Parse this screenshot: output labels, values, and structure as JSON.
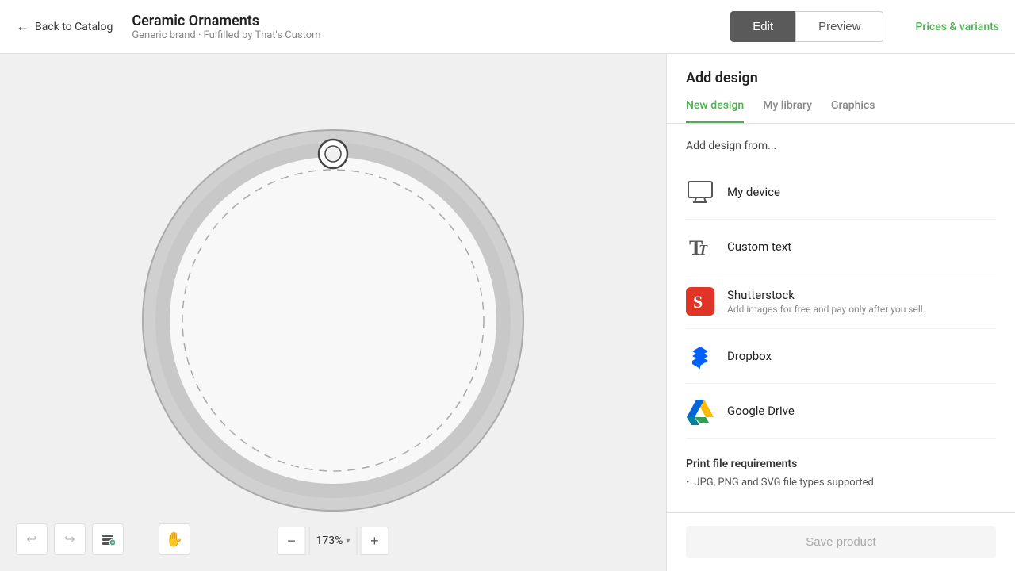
{
  "header": {
    "back_label": "Back to Catalog",
    "product_title": "Ceramic Ornaments",
    "product_subtitle": "Generic brand · Fulfilled by That's Custom",
    "tab_edit": "Edit",
    "tab_preview": "Preview",
    "prices_link": "Prices & variants"
  },
  "panel": {
    "title": "Add design",
    "tabs": [
      {
        "label": "New design",
        "active": true
      },
      {
        "label": "My library",
        "active": false
      },
      {
        "label": "Graphics",
        "active": false
      }
    ],
    "add_from_label": "Add design from...",
    "sources": [
      {
        "name": "My device",
        "desc": "",
        "icon": "monitor"
      },
      {
        "name": "Custom text",
        "desc": "",
        "icon": "text"
      },
      {
        "name": "Shutterstock",
        "desc": "Add images for free and pay only after you sell.",
        "icon": "shutterstock"
      },
      {
        "name": "Dropbox",
        "desc": "",
        "icon": "dropbox"
      },
      {
        "name": "Google Drive",
        "desc": "",
        "icon": "googledrive"
      }
    ],
    "print_requirements": {
      "title": "Print file requirements",
      "items": [
        "JPG, PNG and SVG file types supported"
      ]
    },
    "save_btn_label": "Save product"
  },
  "toolbar": {
    "zoom_value": "173%",
    "zoom_dropdown": "▾"
  }
}
